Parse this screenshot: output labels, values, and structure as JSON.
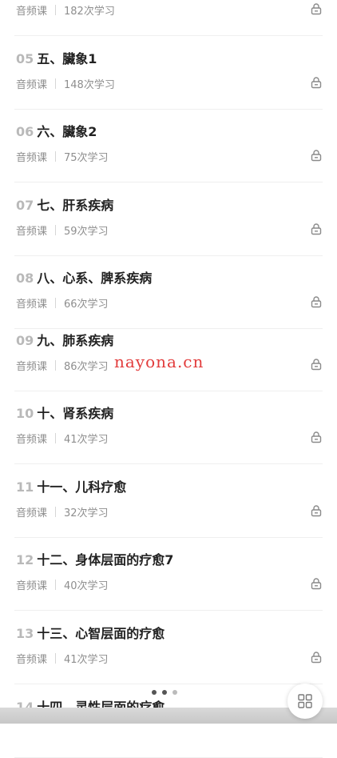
{
  "watermark": "nayona.cn",
  "lessons": [
    {
      "num": "",
      "title": "",
      "type": "音频课",
      "count": "182次学习"
    },
    {
      "num": "05",
      "title": "五、臟象1",
      "type": "音频课",
      "count": "148次学习"
    },
    {
      "num": "06",
      "title": "六、臟象2",
      "type": "音频课",
      "count": "75次学习"
    },
    {
      "num": "07",
      "title": "七、肝系疾病",
      "type": "音频课",
      "count": "59次学习"
    },
    {
      "num": "08",
      "title": "八、心系、脾系疾病",
      "type": "音频课",
      "count": "66次学习"
    },
    {
      "num": "09",
      "title": "九、肺系疾病",
      "type": "音频课",
      "count": "86次学习"
    },
    {
      "num": "10",
      "title": "十、肾系疾病",
      "type": "音频课",
      "count": "41次学习"
    },
    {
      "num": "11",
      "title": "十一、儿科疗愈",
      "type": "音频课",
      "count": "32次学习"
    },
    {
      "num": "12",
      "title": "十二、身体层面的疗愈7",
      "type": "音频课",
      "count": "40次学习"
    },
    {
      "num": "13",
      "title": "十三、心智层面的疗愈",
      "type": "音频课",
      "count": "41次学习"
    },
    {
      "num": "14",
      "title": "十四、灵性层面的疗愈",
      "type": "",
      "count": ""
    }
  ]
}
